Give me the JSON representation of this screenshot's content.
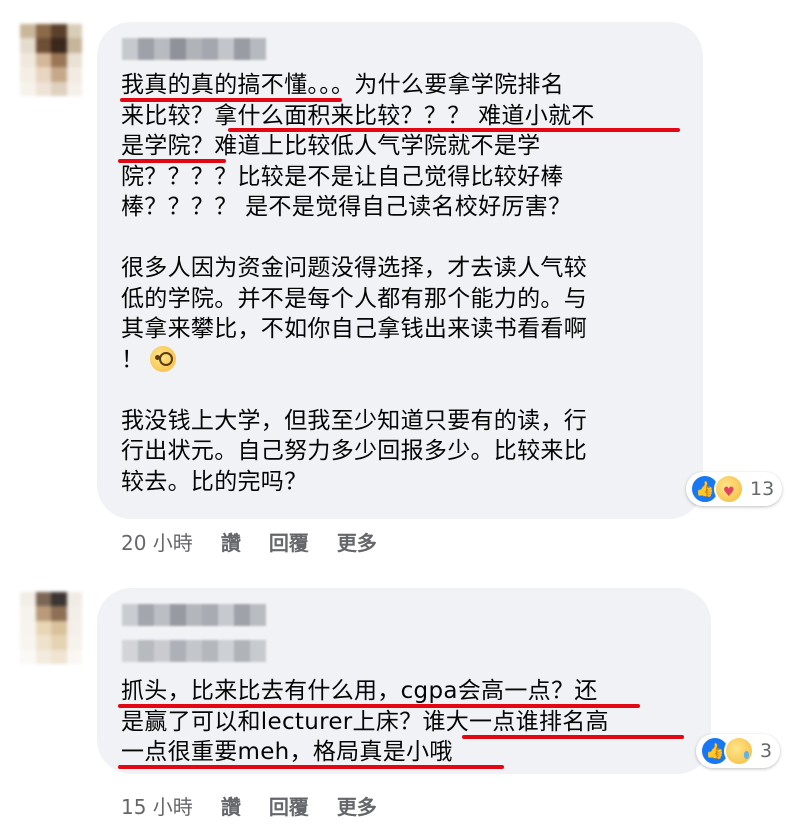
{
  "comments": [
    {
      "lines": [
        "我真的真的搞不懂。。。为什么要拿学院排名",
        "来比较？拿什么面积来比较？？？ 难道小就不",
        "是学院？难道上比较低人气学院就不是学",
        "院？？？？比较是不是让自己觉得比较好棒",
        "棒？？？？ 是不是觉得自己读名校好厉害？",
        "",
        "很多人因为资金问题没得选择，才去读人气较",
        "低的学院。并不是每个人都有那个能力的。与",
        "其拿来攀比，不如你自己拿钱出来读书看看啊",
        "！",
        "",
        "我没钱上大学，但我至少知道只要有的读，行",
        "行出状元。自己努力多少回报多少。比较来比",
        "较去。比的完吗？"
      ],
      "reaction_count": "13",
      "reaction_icons": [
        "like-icon",
        "care-icon"
      ],
      "time": "20 小時",
      "like_label": "讚",
      "reply_label": "回覆",
      "more_label": "更多"
    },
    {
      "lines": [
        "抓头，比来比去有什么用，cgpa会高一点？还",
        "是赢了可以和lecturer上床？谁大一点谁排名高",
        "一点很重要meh，格局真是小哦"
      ],
      "reaction_count": "3",
      "reaction_icons": [
        "like-icon",
        "sad-icon"
      ],
      "time": "15 小時",
      "like_label": "讚",
      "reply_label": "回覆",
      "more_label": "更多"
    }
  ],
  "colors": {
    "bubble": "#f0f2f5",
    "underline": "#e30613",
    "meta_text": "#65676b",
    "like_blue": "#1877f2"
  }
}
